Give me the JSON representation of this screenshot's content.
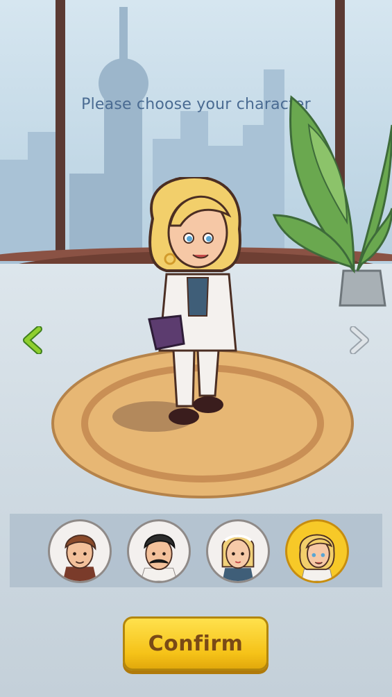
{
  "screen": {
    "title": "Please choose your character",
    "confirm_label": "Confirm"
  },
  "navigation": {
    "prev_icon": "chevron-left-icon",
    "next_icon": "chevron-right-icon",
    "prev_color": "#8fcf2f",
    "next_color": "#cfd6dc"
  },
  "characters": [
    {
      "id": "brown-hair-man",
      "selected": false
    },
    {
      "id": "mustache-man",
      "selected": false
    },
    {
      "id": "headband-girl",
      "selected": false
    },
    {
      "id": "blonde-woman",
      "selected": true
    }
  ],
  "colors": {
    "title_text": "#4a6b92",
    "confirm_button": "#f5c218",
    "confirm_text": "#7a4a16",
    "selected_avatar_ring": "#f7c928"
  }
}
